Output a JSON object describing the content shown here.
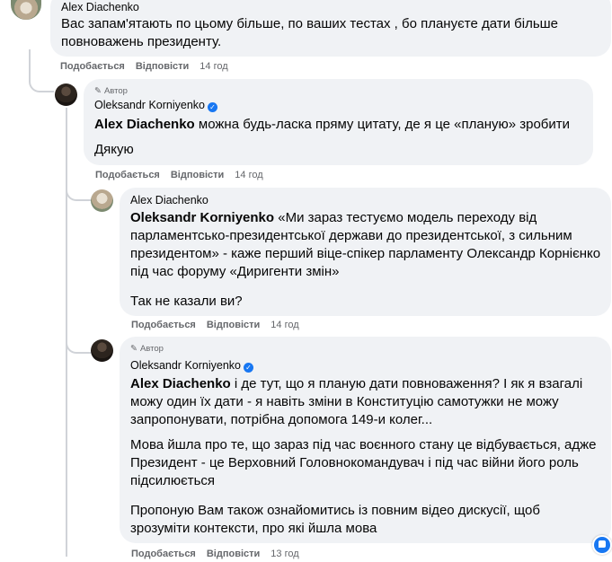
{
  "comment1": {
    "author": "Alex Diachenko",
    "text": "Вас запам'ятають по цьому більше, по ваших тестах , бо плануєте дати більше повноважень президенту.",
    "actions": {
      "like": "Подобається",
      "reply": "Відповісти",
      "time": "14 год"
    }
  },
  "reply1": {
    "author_tag": "Автор",
    "author": "Oleksandr Korniyenko",
    "mention": "Alex Diachenko",
    "text": "можна будь-ласка пряму цитату, де я це «планую» зробити",
    "text2": "Дякую",
    "actions": {
      "like": "Подобається",
      "reply": "Відповісти",
      "time": "14 год"
    }
  },
  "reply2": {
    "author": "Alex Diachenko",
    "mention": "Oleksandr Korniyenko",
    "text": "«Ми зараз тестуємо модель переходу від парламентсько-президентської держави до президентської, з сильним президентом» - каже перший віце-спікер парламенту Олександр Корнієнко під час форуму «Диригенти змін»",
    "text2": "Так не казали ви?",
    "actions": {
      "like": "Подобається",
      "reply": "Відповісти",
      "time": "14 год"
    }
  },
  "reply3": {
    "author_tag": "Автор",
    "author": "Oleksandr Korniyenko",
    "mention": "Alex Diachenko",
    "text": "і де тут, що я планую дати повноваження? І як я взагалі можу один їх дати - я навіть зміни в Конституцію самотужки не можу запропонувати, потрібна допомога 149-и колег...",
    "text2": "Мова йшла про те, що зараз під час воєнного стану це відбувається, адже Президент - це Верховний Головнокомандувач і під час війни його роль підсилюється",
    "text3": "Пропоную Вам також ознайомитись із повним відео дискусії, щоб зрозуміти контексти, про які йшла мова",
    "actions": {
      "like": "Подобається",
      "reply": "Відповісти",
      "time": "13 год"
    }
  },
  "icons": {
    "verified": "verified-badge-icon",
    "author": "pen-icon",
    "messenger": "messenger-icon"
  },
  "colors": {
    "bubble": "#f0f2f5",
    "meta": "#65676b",
    "accent": "#1877f2"
  }
}
